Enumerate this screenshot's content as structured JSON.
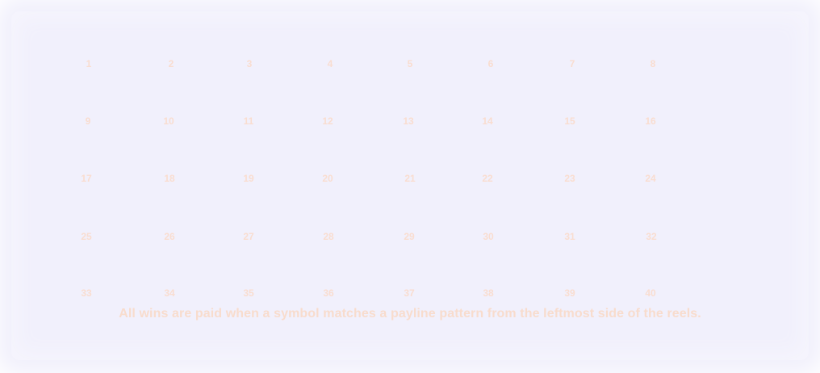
{
  "paylines": {
    "numbers": [
      "1",
      "2",
      "3",
      "4",
      "5",
      "6",
      "7",
      "8",
      "9",
      "10",
      "11",
      "12",
      "13",
      "14",
      "15",
      "16",
      "17",
      "18",
      "19",
      "20",
      "21",
      "22",
      "23",
      "24",
      "25",
      "26",
      "27",
      "28",
      "29",
      "30",
      "31",
      "32",
      "33",
      "34",
      "35",
      "36",
      "37",
      "38",
      "39",
      "40"
    ]
  },
  "info": {
    "rule_text": "All wins are paid when a symbol matches a payline pattern from the leftmost side of the reels."
  },
  "colors": {
    "panel_background": "#f1f0fc",
    "label_color": "#f9ddd0"
  }
}
